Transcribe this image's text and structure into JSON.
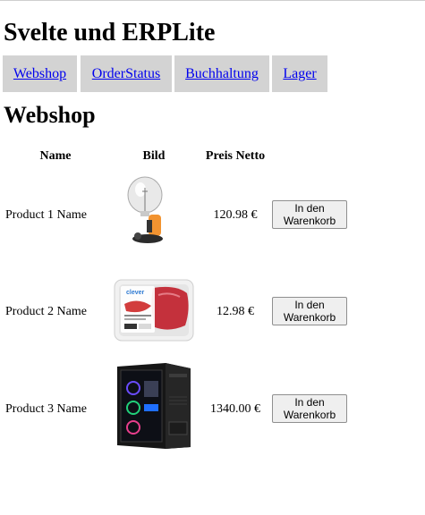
{
  "app": {
    "title": "Svelte und ERPLite"
  },
  "nav": {
    "items": [
      {
        "label": "Webshop"
      },
      {
        "label": "OrderStatus"
      },
      {
        "label": "Buchhaltung"
      },
      {
        "label": "Lager"
      }
    ]
  },
  "page": {
    "title": "Webshop"
  },
  "table": {
    "headers": {
      "name": "Name",
      "image": "Bild",
      "price": "Preis Netto"
    },
    "rows": [
      {
        "name": "Product 1 Name",
        "image": "lamp-image",
        "price": "120.98 €",
        "button": "In den Warenkorb"
      },
      {
        "name": "Product 2 Name",
        "image": "meat-package-image",
        "price": "12.98 €",
        "button": "In den Warenkorb"
      },
      {
        "name": "Product 3 Name",
        "image": "pc-tower-image",
        "price": "1340.00 €",
        "button": "In den Warenkorb"
      }
    ]
  }
}
